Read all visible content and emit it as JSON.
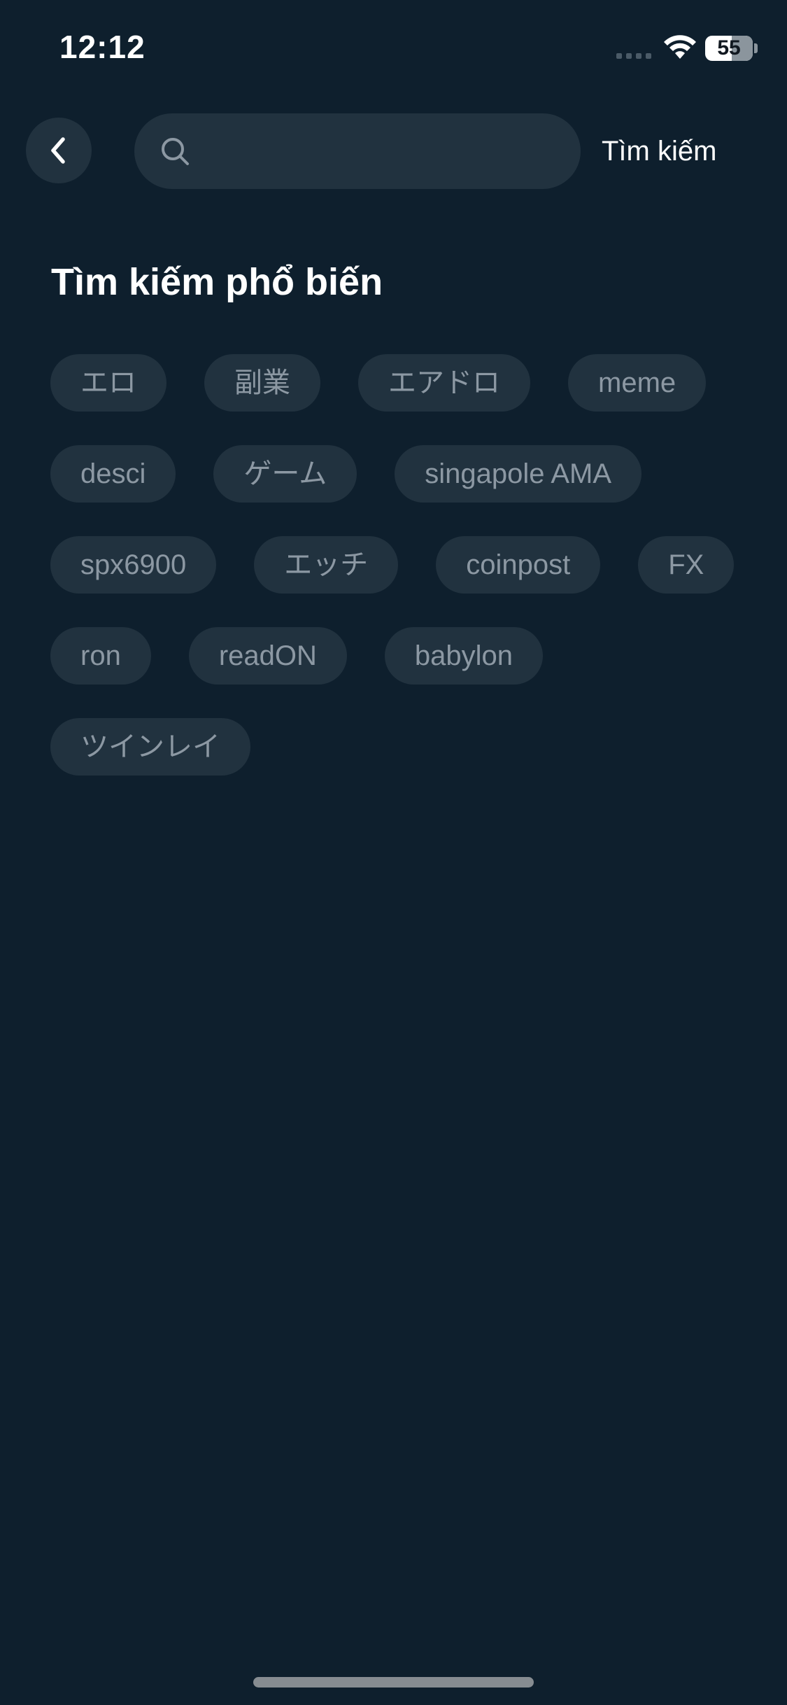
{
  "status_bar": {
    "time": "12:12",
    "battery_level": "55",
    "icons": [
      "signal-icon",
      "wifi-icon",
      "battery-icon"
    ]
  },
  "header": {
    "back_icon": "chevron-left-icon",
    "search_icon": "search-icon",
    "search_placeholder": "",
    "search_value": "",
    "search_button_label": "Tìm kiếm"
  },
  "popular": {
    "title": "Tìm kiếm phổ biến",
    "tags": [
      "エロ",
      "副業",
      "エアドロ",
      "meme",
      "desci",
      "ゲーム",
      "singapole AMA",
      "spx6900",
      "エッチ",
      "coinpost",
      "FX",
      "ron",
      "readON",
      "babylon",
      "ツインレイ"
    ]
  },
  "colors": {
    "background": "#0e1f2d",
    "surface": "#21323f",
    "tag_text": "#8c98a3",
    "primary_text": "#ffffff"
  }
}
